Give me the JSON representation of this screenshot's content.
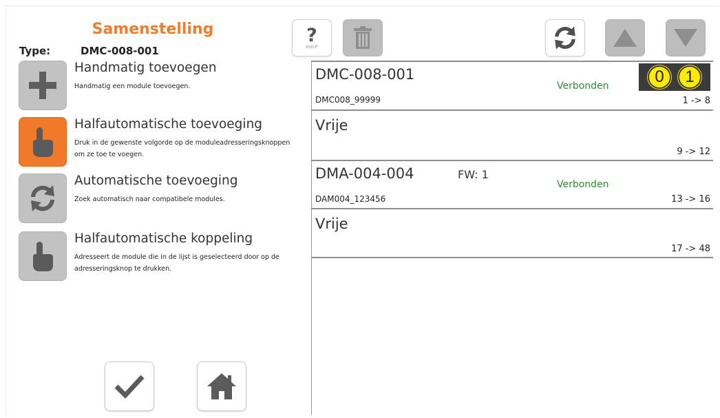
{
  "header": {
    "title": "Samenstelling",
    "type_label": "Type:",
    "type_value": "DMC-008-001"
  },
  "toolbar": {
    "help_symbol": "?",
    "help_label": "HULP",
    "icons": [
      "help-icon",
      "trash-icon",
      "refresh-icon",
      "arrow-up-icon",
      "arrow-down-icon"
    ]
  },
  "actions": [
    {
      "name": "Handmatig toevoegen",
      "desc": "Handmatig een module toevoegen.",
      "icon": "plus-icon",
      "active": false
    },
    {
      "name": "Halfautomatische toevoeging",
      "desc": "Druk in de gewenste volgorde op de moduleadresseringsknoppen om ze toe te voegen.",
      "icon": "hand-pointer-icon",
      "active": true
    },
    {
      "name": "Automatische toevoeging",
      "desc": "Zoek automatisch naar compatibele modules.",
      "icon": "refresh-icon",
      "active": false
    },
    {
      "name": "Halfautomatische koppeling",
      "desc": "Adresseert de module die in de lijst is geselecteerd door op de adresseringsknop te drukken.",
      "icon": "hand-pointer-icon",
      "active": false
    }
  ],
  "modules": [
    {
      "name": "DMC-008-001",
      "fw": "",
      "status": "Verbonden",
      "serial": "DMC008_99999",
      "range": "1 -> 8",
      "address": [
        "0",
        "1"
      ]
    },
    {
      "name": "Vrije",
      "fw": "",
      "status": "",
      "serial": "",
      "range": "9 -> 12"
    },
    {
      "name": "DMA-004-004",
      "fw": "FW: 1",
      "status": "Verbonden",
      "serial": "DAM004_123456",
      "range": "13 -> 16"
    },
    {
      "name": "Vrije",
      "fw": "",
      "status": "",
      "serial": "",
      "range": "17 -> 48"
    }
  ],
  "footer": {
    "icons": [
      "checkmark-icon",
      "home-icon"
    ]
  },
  "colors": {
    "accent": "#f07c2c",
    "status_ok": "#2e8b2e",
    "button_gray": "#c2c2c2",
    "address_bg": "#3b3b3b",
    "address_digit": "#ffeb00"
  }
}
